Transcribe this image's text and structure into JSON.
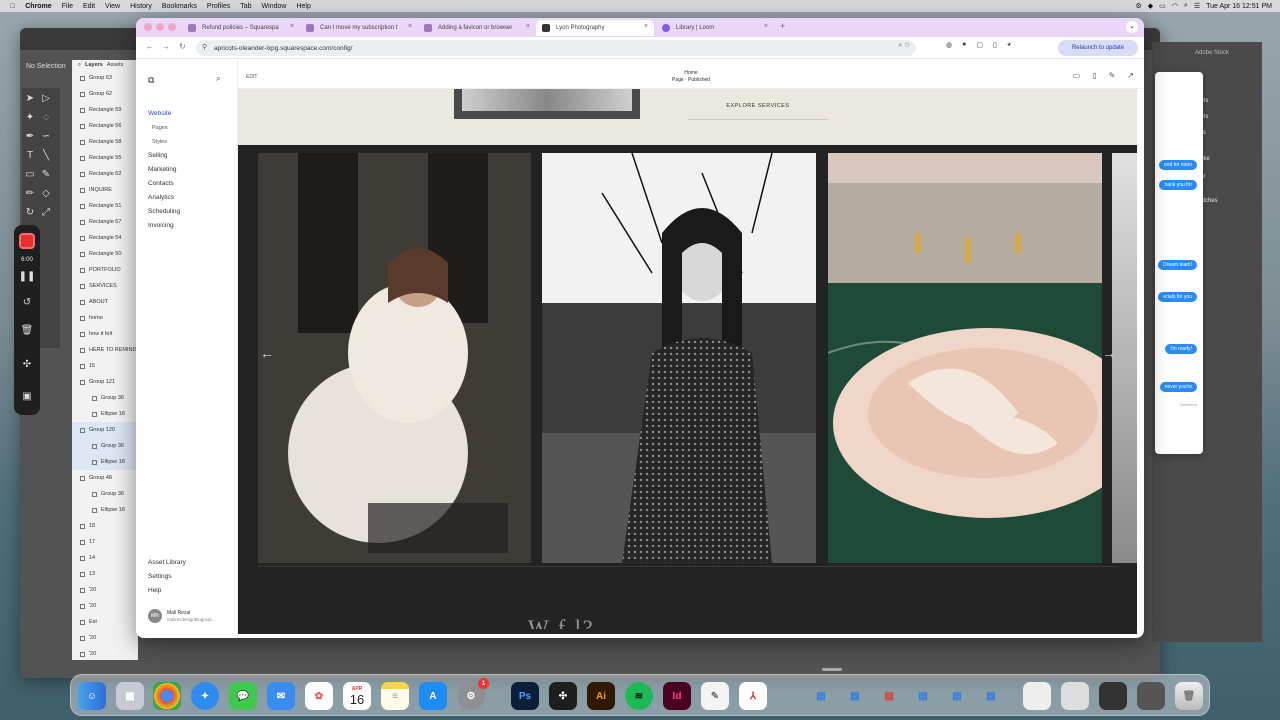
{
  "menubar": {
    "apple": "",
    "app": "Chrome",
    "items": [
      "File",
      "Edit",
      "View",
      "History",
      "Bookmarks",
      "Profiles",
      "Tab",
      "Window",
      "Help"
    ],
    "clock": "Tue Apr 16 12:51 PM"
  },
  "bg_app": {
    "selection": "No Selection",
    "layers_tab": "Layers",
    "assets_tab": "Assets",
    "layers": [
      "Group 63",
      "Group 62",
      "Rectangle 59",
      "Rectangle 56",
      "Rectangle 58",
      "Rectangle 55",
      "Rectangle 52",
      "INQUIRE",
      "Rectangle 51",
      "Rectangle 57",
      "Rectangle 54",
      "Rectangle 50",
      "PORTFOLIO",
      "SERVICES",
      "ABOUT",
      "home",
      "how it felt",
      "HERE TO REMIND",
      "15",
      "Group 121",
      "Group 36",
      "Ellipse 18",
      "Group 120",
      "Group 36",
      "Ellipse 18",
      "Group 48",
      "Group 36",
      "Ellipse 18",
      "18",
      "17",
      "14",
      "13",
      "'20",
      "'20",
      "Est",
      "'20",
      "'20",
      "'20"
    ],
    "recorder_time": "6:00"
  },
  "right_app": {
    "title": "Adobe Stock",
    "items": [
      "ers",
      "ks",
      "oke",
      "or",
      "atches"
    ],
    "messages": [
      "ood for noon",
      "hank you for",
      "Dream team!",
      "erials for you",
      "i'm ready!",
      "never you're"
    ],
    "delivered": "Delivered"
  },
  "chrome": {
    "tabs": [
      {
        "title": "Refund policies – Squarespa",
        "active": false
      },
      {
        "title": "Can I move my subscription t",
        "active": false
      },
      {
        "title": "Adding a favicon or browser",
        "active": false
      },
      {
        "title": "Lyon Photography",
        "active": true
      },
      {
        "title": "Library | Loom",
        "active": false
      }
    ],
    "new_tab": "+",
    "url": "apricots-oleander-lxpg.squarespace.com/config/",
    "relaunch": "Relaunch to update"
  },
  "squarespace": {
    "sidebar": {
      "items": [
        {
          "label": "Website",
          "active": true,
          "sub": false
        },
        {
          "label": "Pages",
          "active": false,
          "sub": true
        },
        {
          "label": "Styles",
          "active": false,
          "sub": true
        },
        {
          "label": "Selling",
          "active": false,
          "sub": false
        },
        {
          "label": "Marketing",
          "active": false,
          "sub": false
        },
        {
          "label": "Contacts",
          "active": false,
          "sub": false
        },
        {
          "label": "Analytics",
          "active": false,
          "sub": false
        },
        {
          "label": "Scheduling",
          "active": false,
          "sub": false
        },
        {
          "label": "Invoicing",
          "active": false,
          "sub": false
        }
      ],
      "bottom": [
        "Asset Library",
        "Settings",
        "Help"
      ],
      "user_initials": "MR",
      "user_name": "Mali Rezai",
      "user_email": "maliresdesignblogmail..."
    },
    "topbar": {
      "edit": "EDIT",
      "page": "Home",
      "status": "Page · Published"
    },
    "page": {
      "cta": "EXPLORE SERVICES",
      "heading_peek": "W                    f          l?"
    }
  },
  "dock": {
    "calendar_month": "APR",
    "calendar_day": "16",
    "settings_badge": "1",
    "apps": [
      "Finder",
      "Launchpad",
      "Chrome",
      "Safari",
      "Messages",
      "Mail",
      "Photos",
      "Calendar",
      "Notes",
      "App Store",
      "System Settings",
      "Photoshop",
      "Figma",
      "Illustrator",
      "Spotify",
      "InDesign",
      "TextEdit",
      "Acrobat"
    ]
  }
}
